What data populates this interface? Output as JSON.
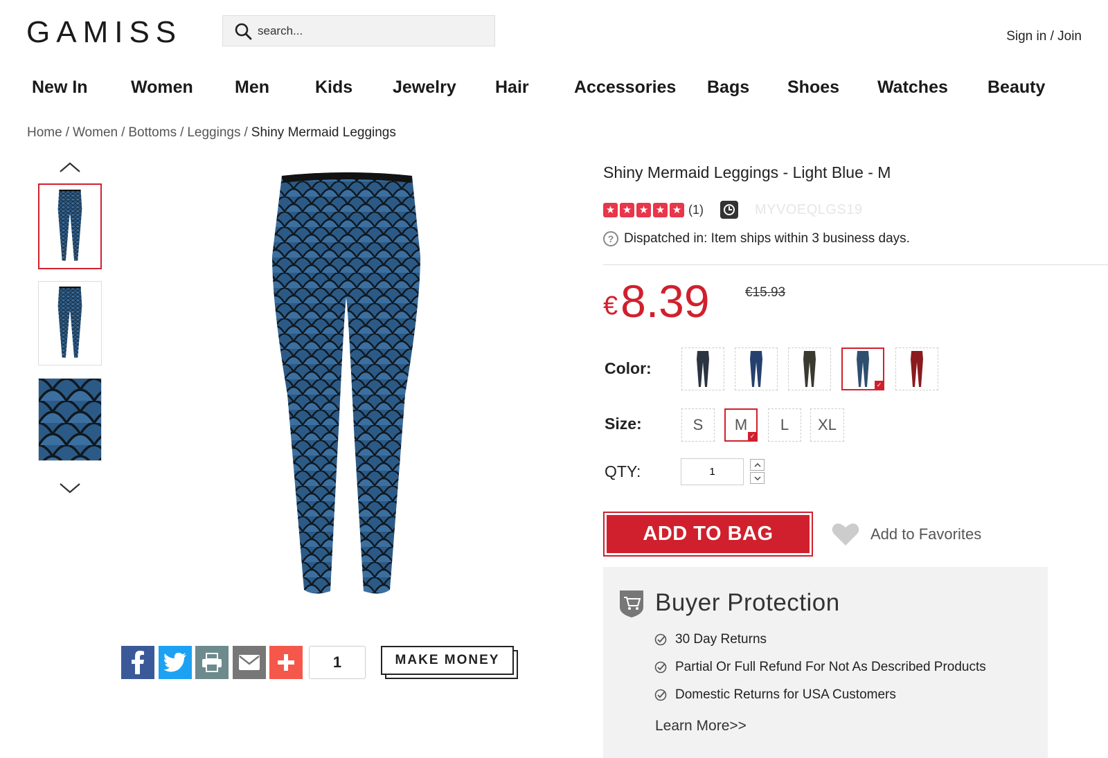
{
  "header": {
    "logo": "GAMISS",
    "search_placeholder": "search...",
    "signin": "Sign in / Join"
  },
  "nav": [
    "New In",
    "Women",
    "Men",
    "Kids",
    "Jewelry",
    "Hair",
    "Accessories",
    "Bags",
    "Shoes",
    "Watches",
    "Beauty"
  ],
  "breadcrumb": [
    "Home",
    "Women",
    "Bottoms",
    "Leggings",
    "Shiny Mermaid Leggings"
  ],
  "product": {
    "title": "Shiny Mermaid Leggings - Light Blue - M",
    "rating": 5,
    "review_count": "(1)",
    "sku": "MYVOEQLGS19",
    "dispatch": "Dispatched in: Item ships within 3 business days.",
    "currency": "€",
    "price": "8.39",
    "old_price": "€15.93",
    "color_label": "Color:",
    "size_label": "Size:",
    "qty_label": "QTY:",
    "sizes": [
      "S",
      "M",
      "L",
      "XL"
    ],
    "selected_size": "M",
    "colors": [
      "#2b3440",
      "#25406e",
      "#3b3a30",
      "#2f4f6f",
      "#8b1a1f"
    ],
    "selected_color_index": 3,
    "qty": "1",
    "add_to_bag": "ADD TO BAG",
    "add_to_favorites": "Add to Favorites"
  },
  "share": {
    "count": "1",
    "make_money": "MAKE MONEY"
  },
  "buyer_protection": {
    "title": "Buyer Protection",
    "items": [
      "30 Day Returns",
      "Partial Or Full Refund For Not As Described Products",
      "Domestic Returns for USA Customers"
    ],
    "learn_more": "Learn More>>"
  },
  "colors": {
    "accent": "#d0202d",
    "fabric": "#2c5a86",
    "scale": "#0f1820"
  }
}
